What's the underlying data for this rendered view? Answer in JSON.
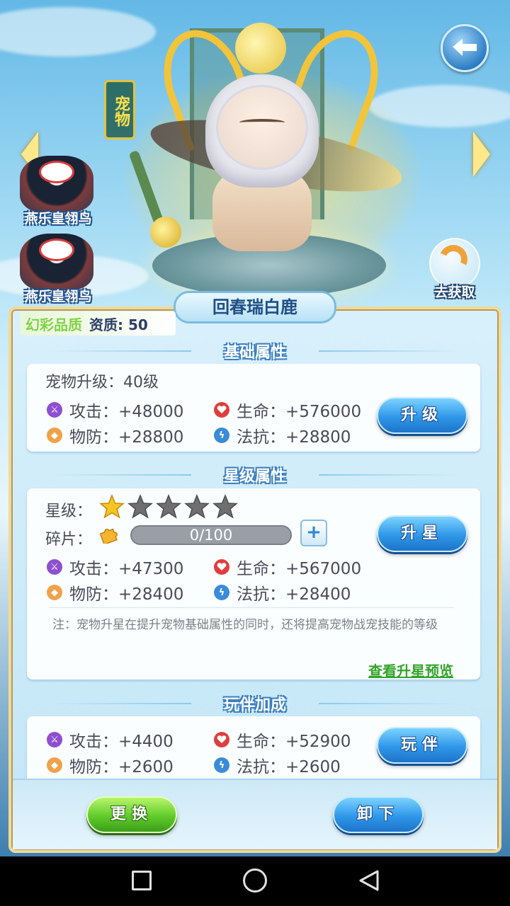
{
  "pet": {
    "tag": "宠物",
    "name": "回春瑞白鹿",
    "quality_label": "幻彩品质",
    "aptitude": "资质: 50",
    "go_get": "去获取"
  },
  "pet_list": [
    {
      "name": "燕乐皇翎鸟"
    },
    {
      "name": "燕乐皇翎鸟"
    }
  ],
  "basic": {
    "title": "基础属性",
    "level": "宠物升级：40级",
    "attack": "攻击：+48000",
    "hp": "生命：+576000",
    "defense": "物防：+28800",
    "resist": "法抗：+28800",
    "button": "升级"
  },
  "star": {
    "title": "星级属性",
    "star_label": "星级：",
    "stars_filled": 1,
    "stars_total": 5,
    "fragment_label": "碎片：",
    "fragment_progress": "0/100",
    "fragment_fraction": 0,
    "attack": "攻击：+47300",
    "hp": "生命：+567000",
    "defense": "物防：+28400",
    "resist": "法抗：+28400",
    "button": "升星",
    "note": "注：宠物升星在提升宠物基础属性的同时，还将提高宠物战宠技能的等级",
    "preview_link": "查看升星预览"
  },
  "partner": {
    "title": "玩伴加成",
    "attack": "攻击：+4400",
    "hp": "生命：+52900",
    "defense": "物防：+2600",
    "resist": "法抗：+2600",
    "button": "玩伴"
  },
  "actions": {
    "replace": "更换",
    "unload": "卸下"
  },
  "colors": {
    "quality": "#7dd23e",
    "blue_button": "#2f97e9",
    "green_button": "#5fcb2a",
    "star_active": "#f5c521",
    "star_inactive": "#6f6f6f",
    "link": "#34a32a"
  },
  "icons": {
    "attack": "sword-icon",
    "hp": "heart-icon",
    "defense": "shield-icon",
    "resist": "lightning-icon",
    "back": "back-arrow-icon",
    "fragment": "puzzle-icon"
  },
  "system_nav": [
    "recent-apps",
    "home",
    "back"
  ]
}
